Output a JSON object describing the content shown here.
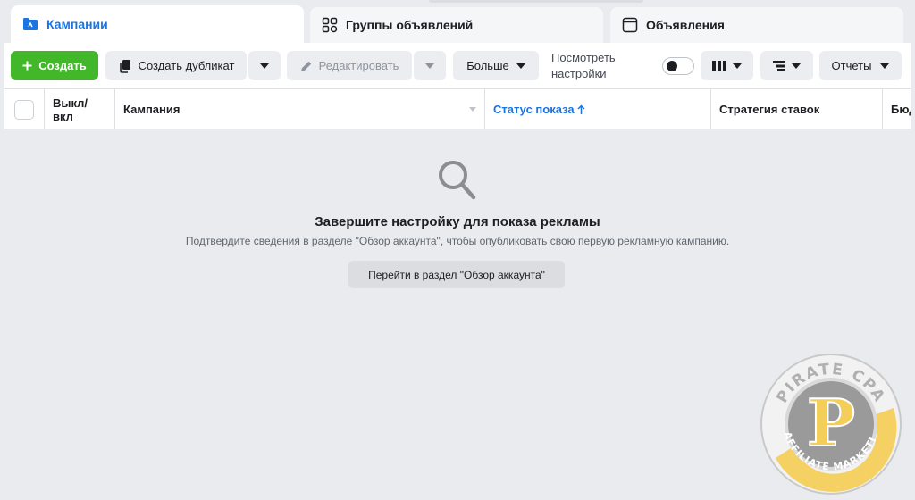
{
  "tabs": [
    {
      "label": "Кампании",
      "icon": "folder-icon",
      "active": true
    },
    {
      "label": "Группы объявлений",
      "icon": "grid-icon",
      "active": false
    },
    {
      "label": "Объявления",
      "icon": "ad-window-icon",
      "active": false
    }
  ],
  "toolbar": {
    "create_label": "Создать",
    "duplicate_label": "Создать дубликат",
    "edit_label": "Редактировать",
    "more_label": "Больше",
    "view_settings_label": "Посмотреть настройки",
    "view_settings_on": false,
    "reports_label": "Отчеты"
  },
  "table": {
    "columns": [
      "Выкл/ вкл",
      "Кампания",
      "Статус показа",
      "Стратегия ставок",
      "Бюд"
    ],
    "sorted_column": "Статус показа",
    "sort_direction": "ascending"
  },
  "empty_state": {
    "icon": "search-icon",
    "title": "Завершите настройку для показа рекламы",
    "description": "Подтвердите сведения в разделе \"Обзор аккаунта\", чтобы опубликовать свою первую рекламную кампанию.",
    "button_label": "Перейти в раздел \"Обзор аккаунта\""
  },
  "watermark": {
    "top_text": "PIRATE CPA",
    "bottom_text": "AFFILIATE MARKETING",
    "letter": "P"
  },
  "colors": {
    "accent_blue": "#1b74e4",
    "create_green": "#42b72a",
    "background": "#e9ebee",
    "badge_gold": "#f3cf5a"
  }
}
